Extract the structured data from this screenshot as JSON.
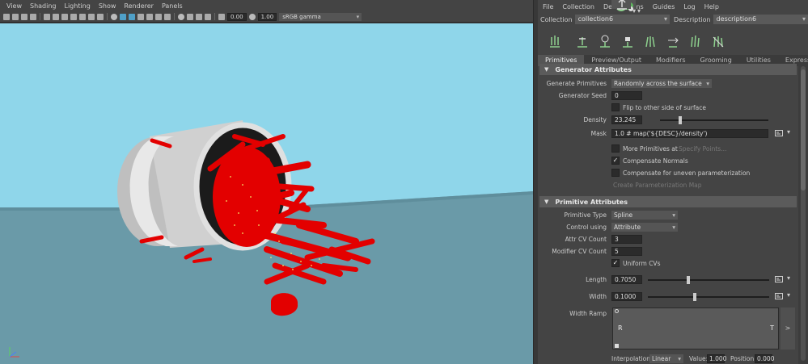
{
  "viewport": {
    "menu": [
      "View",
      "Shading",
      "Lighting",
      "Show",
      "Renderer",
      "Panels"
    ],
    "toolbar": {
      "exposure": "0.00",
      "gamma": "1.00",
      "color_space": "sRGB gamma"
    },
    "colors": {
      "sky": "#8fd6ea",
      "ground": "#6a9aa8",
      "object_red": "#e30000",
      "cylinder": "#d4d4d4"
    }
  },
  "panel": {
    "menu": [
      "File",
      "Collection",
      "Descriptions",
      "Guides",
      "Log",
      "Help"
    ],
    "collection_label": "Collection",
    "collection_value": "collection6",
    "description_label": "Description",
    "description_value": "description6",
    "tabs": [
      {
        "label": "Primitives",
        "active": true
      },
      {
        "label": "Preview/Output",
        "active": false
      },
      {
        "label": "Modifiers",
        "active": false
      },
      {
        "label": "Grooming",
        "active": false
      },
      {
        "label": "Utilities",
        "active": false
      },
      {
        "label": "Expressions",
        "active": false
      }
    ],
    "generator": {
      "title": "Generator Attributes",
      "generate_primitives_label": "Generate Primitives",
      "generate_primitives_value": "Randomly across the surface",
      "seed_label": "Generator Seed",
      "seed_value": "0",
      "flip_label": "Flip to other side of surface",
      "density_label": "Density",
      "density_value": "23.245",
      "density_fraction": 0.17,
      "mask_label": "Mask",
      "mask_value": "1.0 # map('${DESC}/density')",
      "more_primitives_label": "More Primitives at",
      "specify_points_label": "Specify Points...",
      "compensate_normals_label": "Compensate Normals",
      "compensate_uneven_label": "Compensate for uneven parameterization",
      "create_map_label": "Create Parameterization Map"
    },
    "primitive": {
      "title": "Primitive Attributes",
      "type_label": "Primitive Type",
      "type_value": "Spline",
      "control_label": "Control using",
      "control_value": "Attribute",
      "attr_cv_label": "Attr CV Count",
      "attr_cv_value": "3",
      "modifier_cv_label": "Modifier CV Count",
      "modifier_cv_value": "5",
      "uniform_label": "Uniform CVs",
      "length_label": "Length",
      "length_value": "0.7050",
      "length_fraction": 0.32,
      "width_label": "Width",
      "width_value": "0.1000",
      "width_fraction": 0.37,
      "ramp_label": "Width Ramp",
      "ramp_r": "R",
      "ramp_t": "T",
      "ramp_expand": ">",
      "interp_label": "Interpolation:",
      "interp_value": "Linear",
      "value_label": "Value:",
      "value_value": "1.000",
      "position_label": "Position:",
      "position_value": "0.000"
    }
  }
}
